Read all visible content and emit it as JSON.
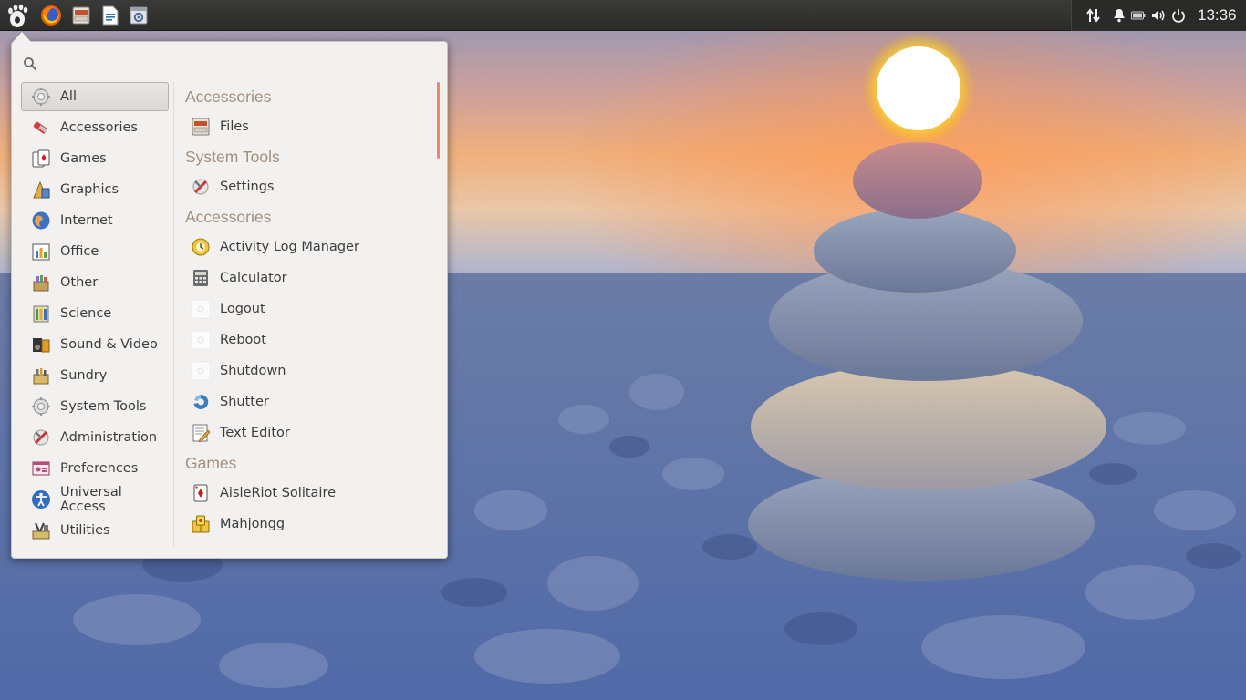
{
  "panel": {
    "launchers": [
      {
        "name": "gnome-foot-icon"
      },
      {
        "name": "firefox-icon"
      },
      {
        "name": "files-icon"
      },
      {
        "name": "document-icon"
      },
      {
        "name": "settings-window-icon"
      }
    ],
    "tray": {
      "icons": [
        "network-icon",
        "notification-bell-icon",
        "battery-icon",
        "volume-icon",
        "power-icon"
      ],
      "clock": "13:36"
    }
  },
  "menu": {
    "search": {
      "placeholder": "",
      "value": ""
    },
    "categories": [
      {
        "label": "All",
        "icon": "all-gear-icon",
        "selected": true
      },
      {
        "label": "Accessories",
        "icon": "accessories-icon"
      },
      {
        "label": "Games",
        "icon": "games-icon"
      },
      {
        "label": "Graphics",
        "icon": "graphics-icon"
      },
      {
        "label": "Internet",
        "icon": "internet-globe-icon"
      },
      {
        "label": "Office",
        "icon": "office-icon"
      },
      {
        "label": "Other",
        "icon": "other-icon"
      },
      {
        "label": "Science",
        "icon": "science-icon"
      },
      {
        "label": "Sound & Video",
        "icon": "sound-video-icon"
      },
      {
        "label": "Sundry",
        "icon": "sundry-icon"
      },
      {
        "label": "System Tools",
        "icon": "system-tools-gear-icon"
      },
      {
        "label": "Administration",
        "icon": "administration-icon"
      },
      {
        "label": "Preferences",
        "icon": "preferences-icon"
      },
      {
        "label": "Universal Access",
        "icon": "universal-access-icon"
      },
      {
        "label": "Utilities",
        "icon": "utilities-icon"
      }
    ],
    "sections": [
      {
        "heading": "Accessories",
        "apps": [
          {
            "label": "Files",
            "icon": "files-cabinet-icon"
          }
        ]
      },
      {
        "heading": "System Tools",
        "apps": [
          {
            "label": "Settings",
            "icon": "settings-tools-icon"
          }
        ]
      },
      {
        "heading": "Accessories",
        "apps": [
          {
            "label": "Activity Log Manager",
            "icon": "activity-log-icon"
          },
          {
            "label": "Calculator",
            "icon": "calculator-icon"
          },
          {
            "label": "Logout",
            "icon": "logout-icon"
          },
          {
            "label": "Reboot",
            "icon": "reboot-icon"
          },
          {
            "label": "Shutdown",
            "icon": "shutdown-icon"
          },
          {
            "label": "Shutter",
            "icon": "shutter-icon"
          },
          {
            "label": "Text Editor",
            "icon": "text-editor-icon"
          }
        ]
      },
      {
        "heading": "Games",
        "apps": [
          {
            "label": "AisleRiot Solitaire",
            "icon": "solitaire-cards-icon"
          },
          {
            "label": "Mahjongg",
            "icon": "mahjongg-icon"
          }
        ]
      }
    ]
  },
  "colors": {
    "panel": "#2b2b2a",
    "menu_bg": "#f2f1f0",
    "section_heading": "#a1907e",
    "scroll_accent": "#e9886a"
  }
}
